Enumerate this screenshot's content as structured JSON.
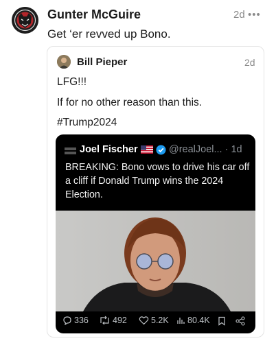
{
  "post": {
    "author": "Gunter McGuire",
    "time": "2d",
    "more_icon": "ellipsis-icon",
    "text": "Get ‘er revved up Bono."
  },
  "quote": {
    "author": "Bill Pieper",
    "time": "2d",
    "lines": [
      "LFG!!!",
      "If for no other reason than this.",
      "#Trump2024"
    ],
    "embedded_tweet": {
      "author": "Joel Fischer",
      "flag": "us-flag-icon",
      "verified": "verified-badge-icon",
      "handle": "@realJoel... · 1d",
      "text": "BREAKING: Bono vows to drive his car off a cliff if Donald Trump wins the 2024 Election.",
      "stats": {
        "replies": "336",
        "reposts": "492",
        "likes": "5.2K",
        "views": "80.4K"
      }
    }
  },
  "colors": {
    "text": "#1a1a1a",
    "muted": "#8a8a8a",
    "card_border": "#e3e3e3",
    "tweet_bg": "#000000",
    "verified": "#1d9bf0"
  }
}
